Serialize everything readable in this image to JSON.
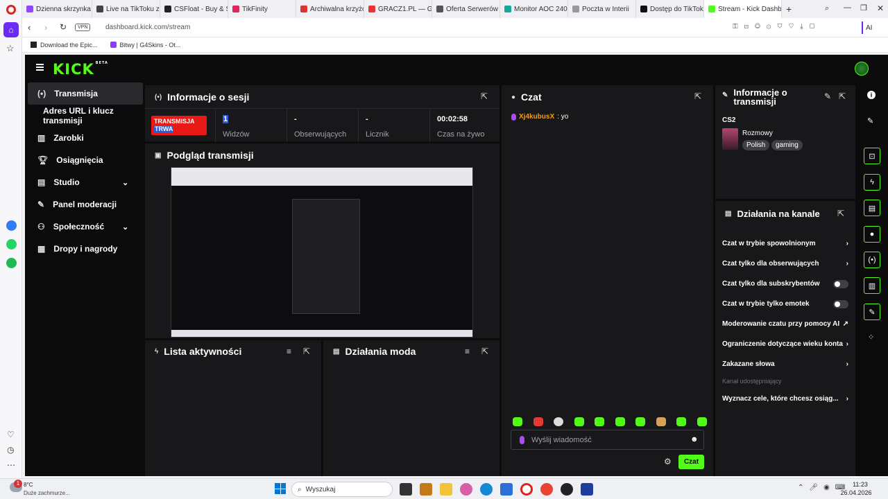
{
  "browser": {
    "tabs": [
      "Dzienna skrzynka | G4S",
      "Live na TikToku z OBS",
      "CSFloat - Buy & Sell C",
      "TikFinity",
      "Archiwalna krzyżówka",
      "GRACZ1.PL — Graj",
      "Oferta Serwerów Mine",
      "Monitor AOC 240 hz C",
      "Poczta w Interii",
      "Dostęp do TikTok LIVE",
      "Stream - Kick Dashbo"
    ],
    "new_tab": "+",
    "vpn": "VPN",
    "url": "dashboard.kick.com/stream",
    "ai_label": "AI",
    "bookmarks": [
      "Download the Epic...",
      "Bitwy | G4Skins - Ot..."
    ]
  },
  "kick": {
    "logo": "KICK",
    "beta": "BETA",
    "nav": [
      {
        "label": "Transmisja"
      },
      {
        "label": "Adres URL i klucz transmisji"
      },
      {
        "label": "Zarobki"
      },
      {
        "label": "Osiągnięcia"
      },
      {
        "label": "Studio"
      },
      {
        "label": "Panel moderacji"
      },
      {
        "label": "Społeczność"
      },
      {
        "label": "Dropy i nagrody"
      }
    ],
    "session": {
      "title": "Informacje o sesji",
      "live_badge_1": "TRANSMISJA",
      "live_badge_2": "TRWA",
      "stats": [
        {
          "value": "1",
          "label": "Widzów"
        },
        {
          "value": "-",
          "label": "Obserwujących"
        },
        {
          "value": "-",
          "label": "Licznik"
        },
        {
          "value": "00:02:58",
          "label": "Czas na żywo"
        }
      ]
    },
    "preview": {
      "title": "Podgląd transmisji"
    },
    "activity": {
      "title": "Lista aktywności"
    },
    "modactions": {
      "title": "Działania moda"
    },
    "chat": {
      "title": "Czat",
      "messages": [
        {
          "user": "Xj4kubusX",
          "text": ": yo"
        }
      ],
      "input_placeholder": "Wyślij wiadomość",
      "send": "Czat"
    },
    "stream_info": {
      "title": "Informacje o transmisji",
      "stream_title": "CS2",
      "category": "Rozmowy",
      "tags": [
        "Polish",
        "gaming"
      ]
    },
    "channel_actions": {
      "title": "Działania na kanale",
      "items": [
        {
          "label": "Czat w trybie spowolnionym",
          "control": "chevron"
        },
        {
          "label": "Czat tylko dla obserwujących",
          "control": "chevron"
        },
        {
          "label": "Czat tylko dla subskrybentów",
          "control": "toggle"
        },
        {
          "label": "Czat w trybie tylko emotek",
          "control": "toggle"
        },
        {
          "label": "Moderowanie czatu przy pomocy AI",
          "control": "external"
        },
        {
          "label": "Ograniczenie dotyczące wieku konta",
          "control": "chevron"
        },
        {
          "label": "Zakazane słowa",
          "control": "chevron"
        }
      ],
      "section": "Kanał udostępniający",
      "goal": "Wyznacz cele, które chcesz osiąg..."
    }
  },
  "taskbar": {
    "weather_temp": "8°C",
    "weather_desc": "Duże zachmurze...",
    "badge": "1",
    "search": "Wyszukaj",
    "time": "11:23",
    "date": "26.04.2026"
  },
  "colors": {
    "accent": "#53fc18",
    "live": "#e91916",
    "panel": "#18181b",
    "bg": "#0b0b0c"
  }
}
